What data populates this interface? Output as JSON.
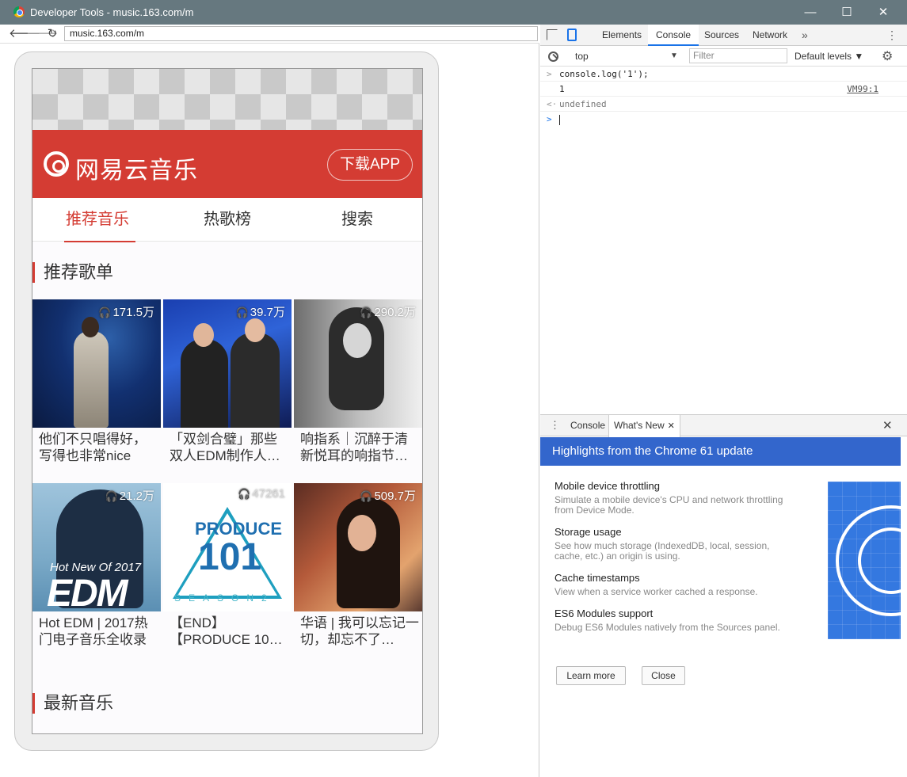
{
  "window": {
    "title": "Developer Tools - music.163.com/m",
    "minimize_glyph": "—",
    "maximize_glyph": "☐",
    "close_glyph": "✕"
  },
  "browser": {
    "back_glyph": "🡐",
    "forward_glyph": "🡒",
    "reload_glyph": "↻",
    "url": "music.163.com/m"
  },
  "page": {
    "logo_text": "网易云音乐",
    "download_button": "下载APP",
    "tabs": [
      "推荐音乐",
      "热歌榜",
      "搜索"
    ],
    "section_recommended": "推荐歌单",
    "section_new": "最新音乐",
    "playlists": [
      {
        "plays": "171.5万",
        "title": "他们不只唱得好，写得也非常nice"
      },
      {
        "plays": "39.7万",
        "title": "「双剑合璧」那些双人EDM制作人…"
      },
      {
        "plays": "290.2万",
        "title": "响指系｜沉醉于清新悦耳的响指节…"
      },
      {
        "plays": "21.2万",
        "title": "Hot EDM | 2017热门电子音乐全收录"
      },
      {
        "plays": "47261",
        "title": "【END】【PRODUCE 10…"
      },
      {
        "plays": "509.7万",
        "title": "华语 | 我可以忘记一切，却忘不了…"
      }
    ],
    "cover_text": {
      "edm_small": "Hot New Of 2017",
      "edm_big": "EDM",
      "produce": "PRODUCE",
      "produce_num": "101",
      "season": "SEASON2"
    },
    "headphone_glyph": "🎧"
  },
  "devtools": {
    "tabs": {
      "elements": "Elements",
      "console": "Console",
      "sources": "Sources",
      "network": "Network",
      "more": "»",
      "kebab": "⋮"
    },
    "console_bar": {
      "context": "top",
      "context_arrow": "▼",
      "filter_placeholder": "Filter",
      "levels": "Default levels ▼",
      "gear": "⚙"
    },
    "log": [
      {
        "gutter": ">",
        "text": "console.log('1');",
        "source": ""
      },
      {
        "gutter": "",
        "text": "1",
        "source": "VM99:1"
      },
      {
        "gutter": "<·",
        "text": "undefined",
        "source": ""
      }
    ],
    "prompt_gutter": ">",
    "drawer": {
      "kebab": "⋮",
      "tab_console": "Console",
      "tab_whats_new": "What's New",
      "tab_close": "✕",
      "close": "✕",
      "banner": "Highlights from the Chrome 61 update",
      "features": [
        {
          "title": "Mobile device throttling",
          "desc": "Simulate a mobile device's CPU and network throttling from Device Mode."
        },
        {
          "title": "Storage usage",
          "desc": "See how much storage (IndexedDB, local, session, cache, etc.) an origin is using."
        },
        {
          "title": "Cache timestamps",
          "desc": "View when a service worker cached a response."
        },
        {
          "title": "ES6 Modules support",
          "desc": "Debug ES6 Modules natively from the Sources panel."
        }
      ],
      "learn_more": "Learn more",
      "close_button": "Close"
    }
  },
  "colors": {
    "brand_red": "#d43c33",
    "devtools_blue": "#3366cc",
    "titlebar": "#66787f"
  }
}
